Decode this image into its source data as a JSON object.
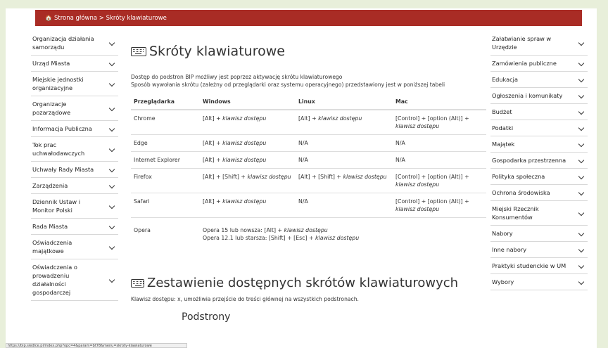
{
  "breadcrumb": {
    "home": "Strona główna",
    "separator": ">",
    "current": "Skróty klawiaturowe"
  },
  "left_nav": [
    "Organizacja działania samorządu",
    "Urząd Miasta",
    "Miejskie jednostki organizacyjne",
    "Organizacje pozarządowe",
    "Informacja Publiczna",
    "Tok prac uchwałodawczych",
    "Uchwały Rady Miasta",
    "Zarządzenia",
    "Dziennik Ustaw i Monitor Polski",
    "Rada Miasta",
    "Oświadczenia majątkowe",
    "Oświadczenia o prowadzeniu działalności gospodarczej"
  ],
  "right_nav": [
    "Załatwianie spraw w Urzędzie",
    "Zamówienia publiczne",
    "Edukacja",
    "Ogłoszenia i komunikaty",
    "Budżet",
    "Podatki",
    "Majątek",
    "Gospodarka przestrzenna",
    "Polityka społeczna",
    "Ochrona środowiska",
    "Miejski Rzecznik Konsumentów",
    "Nabory",
    "Inne nabory",
    "Praktyki studenckie w UM",
    "Wybory"
  ],
  "main": {
    "title": "Skróty klawiaturowe",
    "intro_line1": "Dostęp do podstron BIP możliwy jest poprzez aktywację skrótu klawiaturowego",
    "intro_line2": "Sposób wywołania skrótu (zależny od przeglądarki oraz systemu operacyjnego) przedstawiony jest w poniższej tabeli",
    "table": {
      "headers": [
        "Przeglądarka",
        "Windows",
        "Linux",
        "Mac"
      ],
      "rows": [
        {
          "browser": "Chrome",
          "windows_keys": "[Alt] + ",
          "windows_italic": "klawisz dostępu",
          "linux_keys": "[Alt] + ",
          "linux_italic": "klawisz dostępu",
          "mac_keys": "[Control] + [option (Alt)] + ",
          "mac_italic": "klawisz dostępu"
        },
        {
          "browser": "Edge",
          "windows_keys": "[Alt] + ",
          "windows_italic": "klawisz dostępu",
          "linux_keys": "N/A",
          "linux_italic": "",
          "mac_keys": "N/A",
          "mac_italic": ""
        },
        {
          "browser": "Internet Explorer",
          "windows_keys": "[Alt] + ",
          "windows_italic": "klawisz dostępu",
          "linux_keys": "N/A",
          "linux_italic": "",
          "mac_keys": "N/A",
          "mac_italic": ""
        },
        {
          "browser": "Firefox",
          "windows_keys": "[Alt] + [Shift] + ",
          "windows_italic": "klawisz dostępu",
          "linux_keys": "[Alt] + [Shift] + ",
          "linux_italic": "klawisz dostępu",
          "mac_keys": "[Control] + [option (Alt)] + ",
          "mac_italic": "klawisz dostępu"
        },
        {
          "browser": "Safari",
          "windows_keys": "[Alt] + ",
          "windows_italic": "klawisz dostępu",
          "linux_keys": "N/A",
          "linux_italic": "",
          "mac_keys": "[Control] + [option (Alt)] + ",
          "mac_italic": "klawisz dostępu"
        }
      ],
      "opera": {
        "browser": "Opera",
        "line1_keys": "Opera 15 lub nowsza: [Alt] + ",
        "line1_italic": "klawisz dostępu",
        "line2_keys": "Opera 12.1 lub starsza: [Shift] + [Esc] + ",
        "line2_italic": "klawisz dostępu"
      }
    },
    "subtitle": "Zestawienie dostępnych skrótów klawiaturowych",
    "access_text": "Klawisz dostępu: x, umożliwia przejście do treści głównej na wszystkich podstronach.",
    "section_heading": "Podstrony"
  },
  "status_url": "https://bip.siedlce.pl/index.php?opc=4&param=bt78&menu=skroty-klawiaturowe"
}
